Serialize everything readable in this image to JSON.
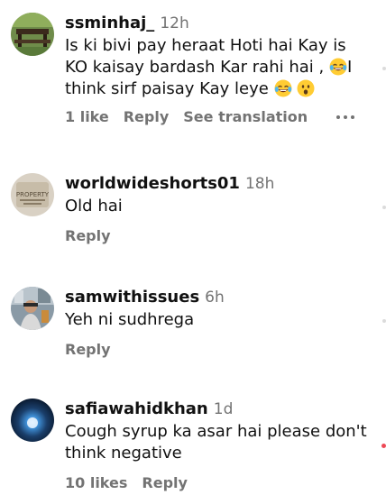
{
  "comments": [
    {
      "username": "ssminhaj_",
      "time": "12h",
      "text_part1": "Is ki bivi pay heraat Hoti hai Kay is KO kaisay bardash Kar rahi hai ,",
      "text_part2": "I think sirf paisay Kay leye",
      "likes": "1 like",
      "reply": "Reply",
      "translate": "See translation"
    },
    {
      "username": "worldwideshorts01",
      "time": "18h",
      "text": "Old hai",
      "reply": "Reply"
    },
    {
      "username": "samwithissues",
      "time": "6h",
      "text": "Yeh ni sudhrega",
      "reply": "Reply"
    },
    {
      "username": "safiawahidkhan",
      "time": "1d",
      "text": "Cough syrup ka asar hai please don't think negative",
      "likes": "10 likes",
      "reply": "Reply"
    }
  ],
  "icons": {
    "laugh": "face-with-tears-of-joy-icon",
    "surprised": "surprised-face-icon",
    "more": "more-options-icon"
  }
}
